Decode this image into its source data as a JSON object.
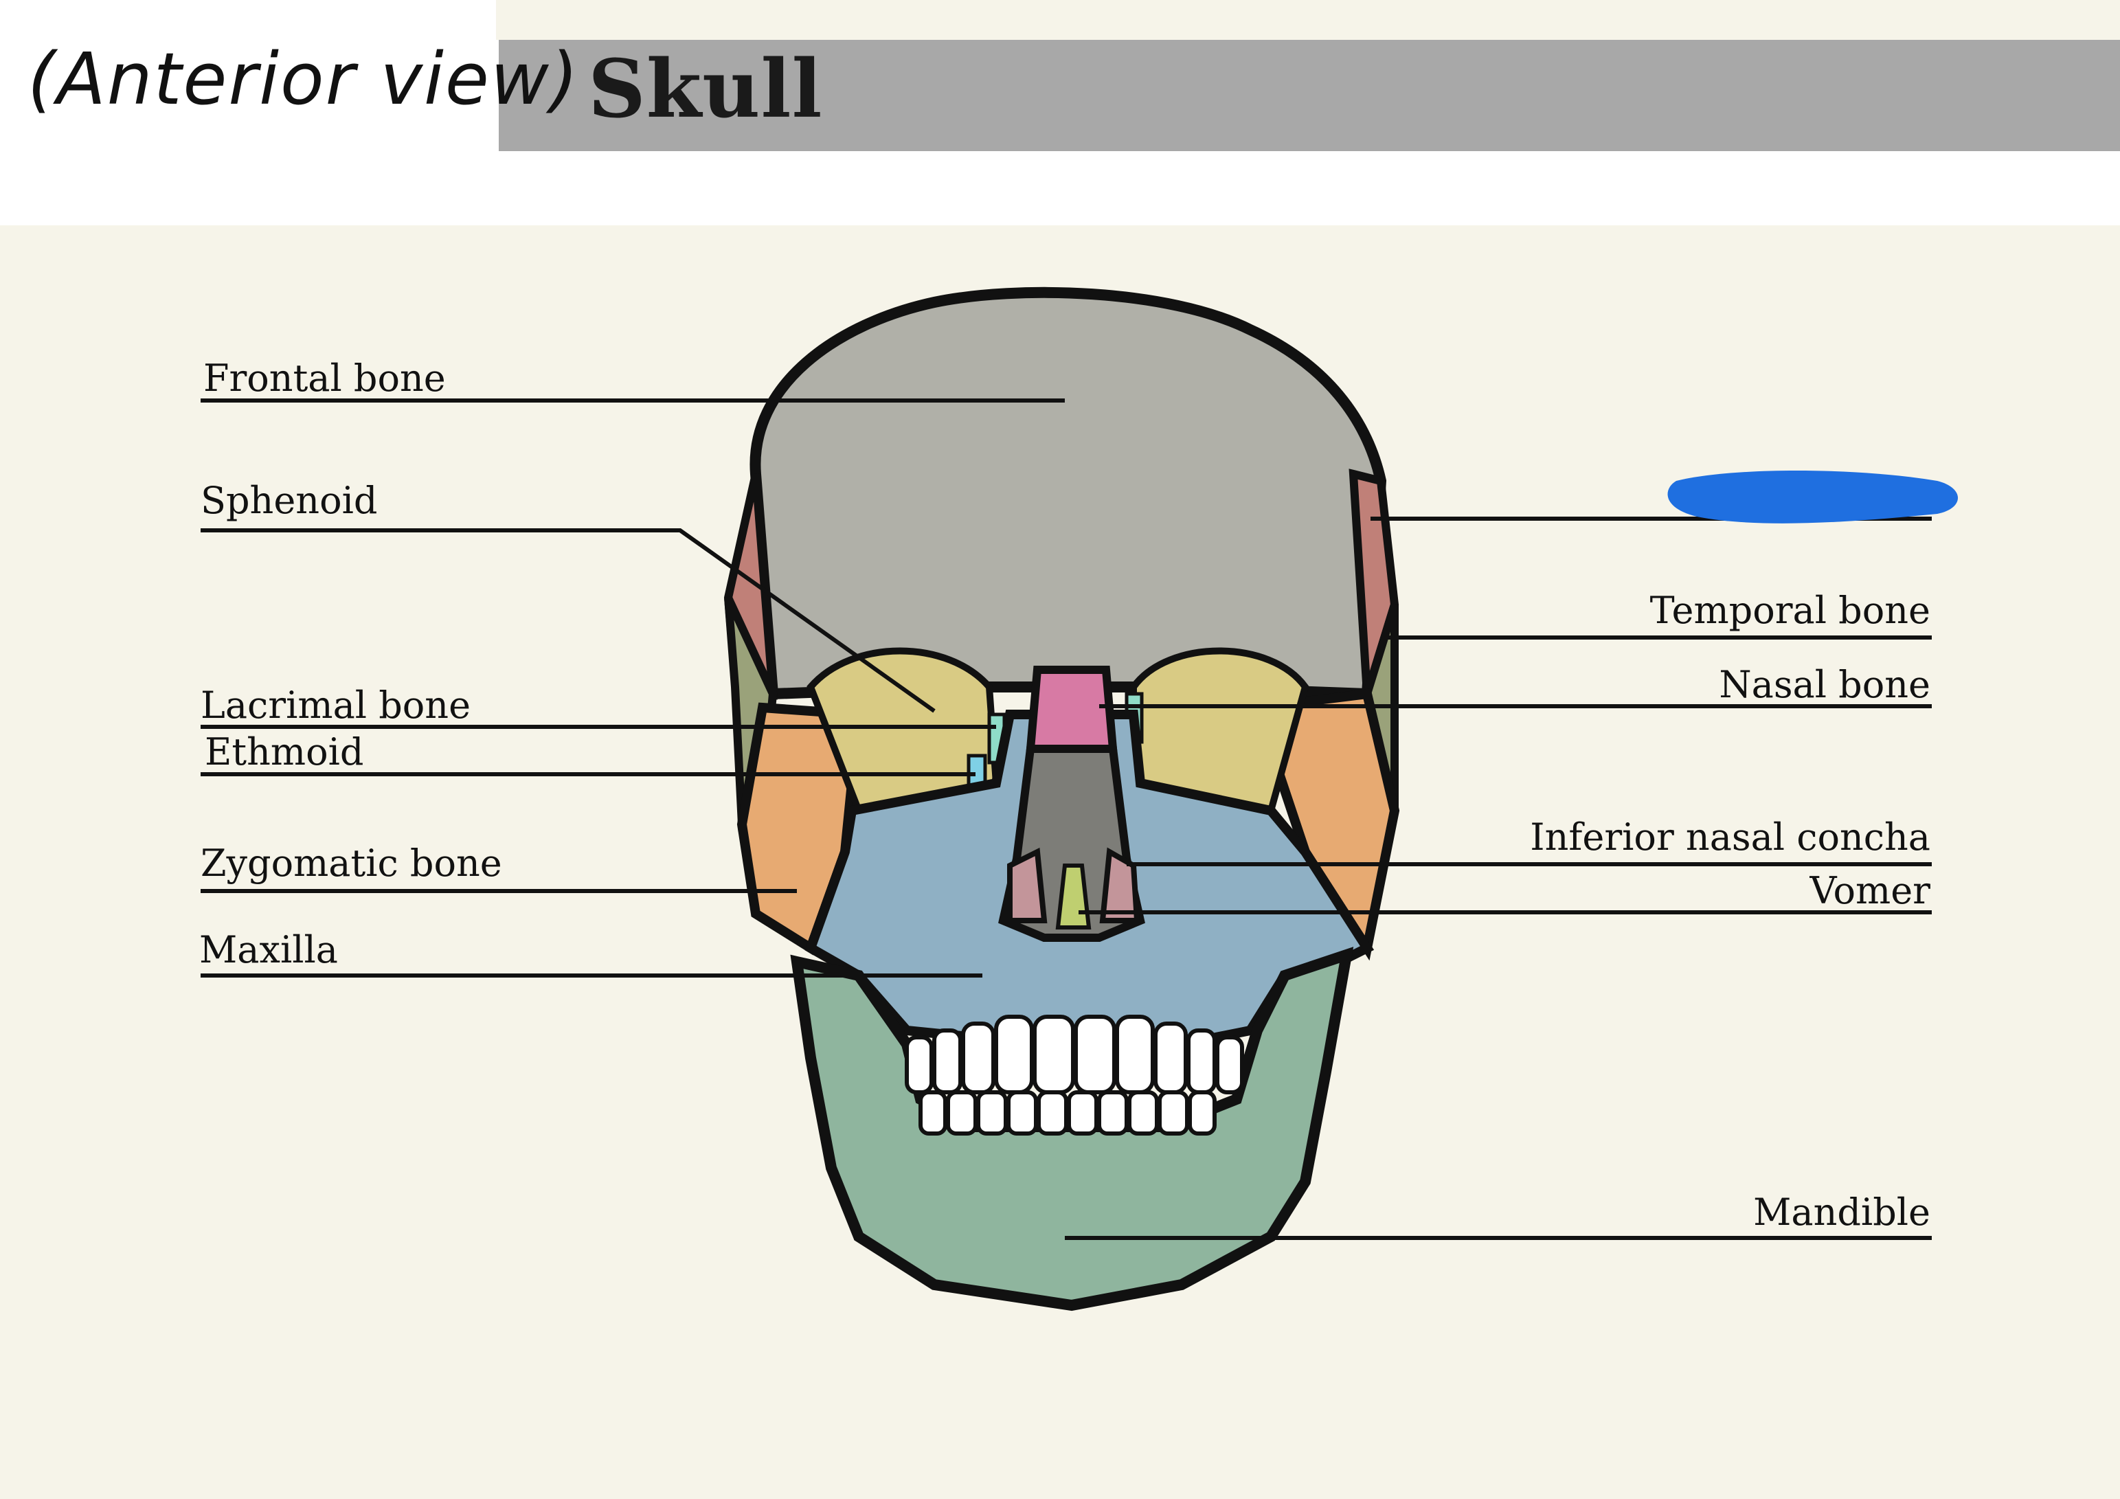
{
  "header": {
    "caption": "(Anterior view)",
    "title": "Skull"
  },
  "colors": {
    "frontal": "#b0b0a8",
    "sphenoid": "#c9a06c",
    "temporal": "#c08078",
    "temporal_lower": "#9aa27a",
    "orbit": "#d9cb84",
    "zygomatic": "#e7aa72",
    "maxilla": "#8fb0c4",
    "nasal": "#d77aa4",
    "vomer_septum": "#7d7d78",
    "inferior_concha": "#c3959a",
    "mandible": "#8fb59e",
    "lacrimal": "#8fdcc8",
    "ethmoid": "#7fd0e6",
    "redaction": "#1f6fe0"
  },
  "labels_left": [
    {
      "id": "frontal",
      "text": "Frontal bone"
    },
    {
      "id": "sphenoid",
      "text": "Sphenoid"
    },
    {
      "id": "lacrimal",
      "text": "Lacrimal bone"
    },
    {
      "id": "ethmoid",
      "text": "Ethmoid"
    },
    {
      "id": "zygomatic",
      "text": "Zygomatic bone"
    },
    {
      "id": "maxilla",
      "text": "Maxilla"
    }
  ],
  "labels_right": [
    {
      "id": "temporal",
      "text": "Temporal bone"
    },
    {
      "id": "nasal",
      "text": "Nasal bone"
    },
    {
      "id": "inferior-concha",
      "text": "Inferior nasal concha"
    },
    {
      "id": "vomer",
      "text": "Vomer"
    },
    {
      "id": "mandible",
      "text": "Mandible"
    }
  ]
}
